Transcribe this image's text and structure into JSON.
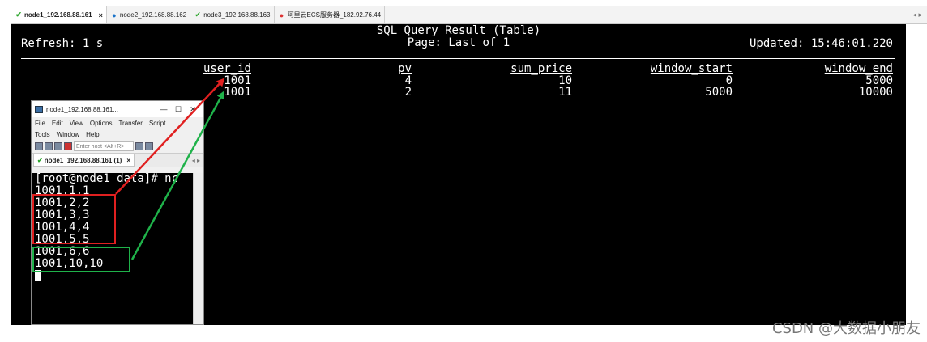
{
  "tabs": [
    {
      "label": "node1_192.168.88.161",
      "icon": "check-icon",
      "active": true
    },
    {
      "label": "node2_192.168.88.162",
      "icon": "info-icon"
    },
    {
      "label": "node3_192.168.88.163",
      "icon": "check-icon"
    },
    {
      "label": "阿里云ECS服务器_182.92.76.44",
      "icon": "error-icon"
    }
  ],
  "tab_close": "×",
  "tab_scroll": "◂ ▸",
  "terminal": {
    "title_line1": "SQL Query Result (Table)",
    "title_line2": "Page: Last of 1",
    "refresh": "Refresh: 1 s",
    "updated": "Updated: 15:46:01.220",
    "columns": [
      {
        "header": "user_id",
        "values": [
          "1001",
          "1001"
        ]
      },
      {
        "header": "pv",
        "values": [
          "4",
          "2"
        ]
      },
      {
        "header": "sum_price",
        "values": [
          "10",
          "11"
        ]
      },
      {
        "header": "window_start",
        "values": [
          "0",
          "5000"
        ]
      },
      {
        "header": "window_end",
        "values": [
          "5000",
          "10000"
        ]
      }
    ]
  },
  "crt": {
    "title": "node1_192.168.88.161...",
    "controls": {
      "minimize": "—",
      "maximize": "☐",
      "close": "✕"
    },
    "menu": [
      "File",
      "Edit",
      "View",
      "Options",
      "Transfer",
      "Script",
      "Tools",
      "Window",
      "Help"
    ],
    "host_placeholder": "Enter host <Alt+R>",
    "tab_label": "node1_192.168.88.161 (1)",
    "tab_close": "×",
    "tab_arrows": "◂ ▸",
    "prompt": "[root@node1 data]# nc",
    "lines": [
      "1001,1,1",
      "1001,2,2",
      "1001,3,3",
      "1001,4,4",
      "1001,5,5",
      "1001,6,6",
      "1001,10,10"
    ]
  },
  "annotations": {
    "red": "#e02020",
    "green": "#1fb24a"
  },
  "watermark": "CSDN @大数据小朋友"
}
